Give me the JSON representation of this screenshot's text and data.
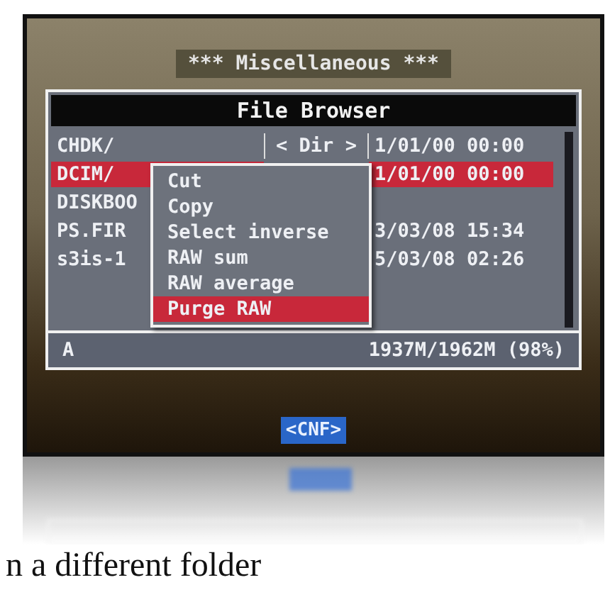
{
  "menu_title": "*** Miscellaneous ***",
  "file_browser": {
    "title": "File Browser",
    "rows": [
      {
        "name": "CHDK/",
        "size": "< Dir >",
        "date": "1/01/00 00:00",
        "selected": false
      },
      {
        "name": "DCIM/",
        "date": "1/01/00 00:00",
        "selected": true
      },
      {
        "name": "DISKBOO",
        "selected": false
      },
      {
        "name": "PS.FIR",
        "date": "3/03/08 15:34",
        "selected": false
      },
      {
        "name": "s3is-1",
        "date": "5/03/08 02:26",
        "selected": false
      }
    ],
    "status_left": "A",
    "status_right": "1937M/1962M (98%)"
  },
  "context_menu": [
    {
      "label": "Cut",
      "selected": false
    },
    {
      "label": "Copy",
      "selected": false
    },
    {
      "label": "Select inverse",
      "selected": false
    },
    {
      "label": "RAW sum",
      "selected": false
    },
    {
      "label": "RAW average",
      "selected": false
    },
    {
      "label": "Purge RAW",
      "selected": true
    }
  ],
  "button": "<CNF>",
  "caption": "n a different folder"
}
